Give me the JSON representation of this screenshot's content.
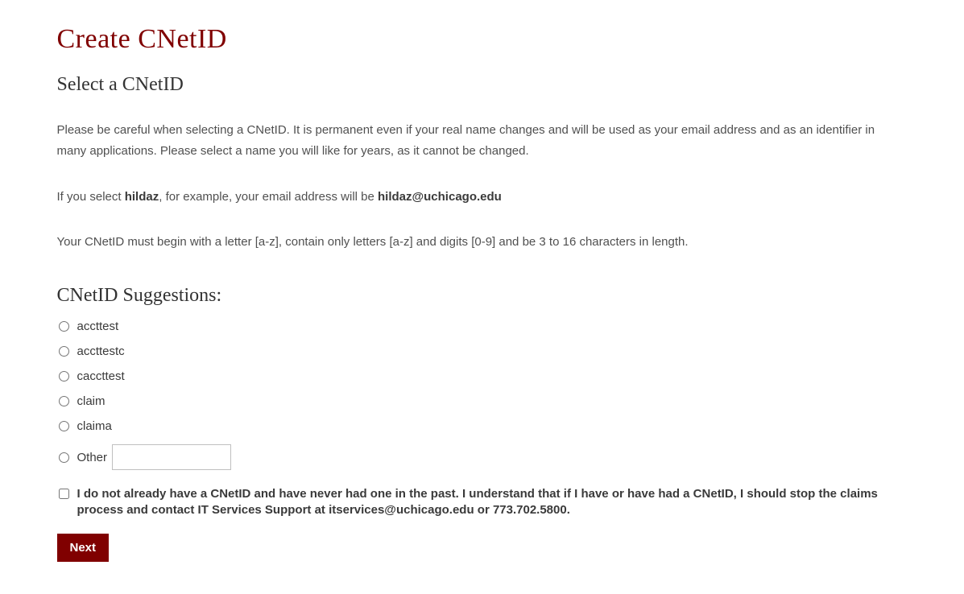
{
  "page": {
    "title": "Create CNetID",
    "subtitle": "Select a CNetID"
  },
  "intro": {
    "careful_text": "Please be careful when selecting a CNetID. It is permanent even if your real name changes and will be used as your email address and as an identifier in many applications. Please select a name you will like for years, as it cannot be changed.",
    "example_prefix": "If you select ",
    "example_name": "hildaz",
    "example_middle": ", for example, your email address will be ",
    "example_email": "hildaz@uchicago.edu",
    "rules_text": "Your CNetID must begin with a letter [a-z], contain only letters [a-z] and digits [0-9] and be 3 to 16 characters in length."
  },
  "suggestions": {
    "heading": "CNetID Suggestions:",
    "options": [
      "accttest",
      "accttestc",
      "caccttest",
      "claim",
      "claima"
    ],
    "other_label": "Other",
    "other_value": ""
  },
  "consent": {
    "text": "I do not already have a CNetID and have never had one in the past. I understand that if I have or have had a CNetID, I should stop the claims process and contact IT Services Support at itservices@uchicago.edu or 773.702.5800."
  },
  "actions": {
    "next_label": "Next"
  }
}
